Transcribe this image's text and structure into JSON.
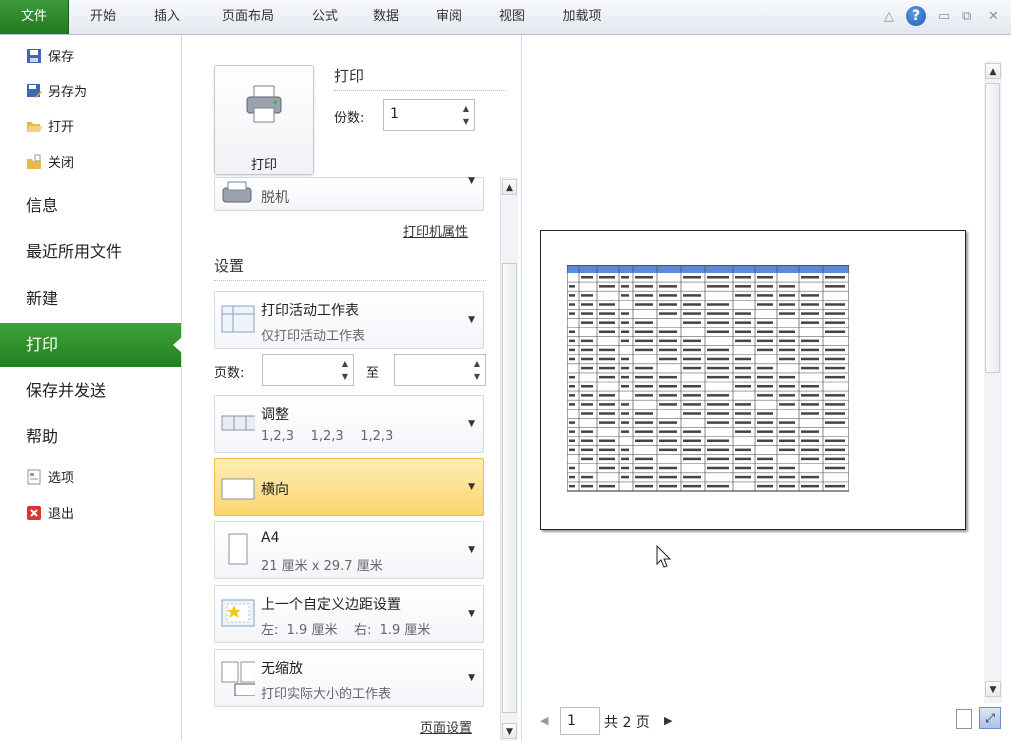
{
  "ribbon": {
    "tabs": [
      "文件",
      "开始",
      "插入",
      "页面布局",
      "公式",
      "数据",
      "审阅",
      "视图",
      "加载项"
    ],
    "window_controls": [
      "minimize-ribbon-icon",
      "help-icon",
      "minimize-icon",
      "restore-icon",
      "close-icon"
    ]
  },
  "backstage_nav": {
    "small_top": [
      {
        "label": "保存",
        "icon": "save-icon"
      },
      {
        "label": "另存为",
        "icon": "save-as-icon"
      },
      {
        "label": "打开",
        "icon": "open-folder-icon"
      },
      {
        "label": "关闭",
        "icon": "close-folder-icon"
      }
    ],
    "big": [
      "信息",
      "最近所用文件",
      "新建",
      "打印",
      "保存并发送",
      "帮助"
    ],
    "selected": "打印",
    "small_bottom": [
      {
        "label": "选项",
        "icon": "options-icon"
      },
      {
        "label": "退出",
        "icon": "exit-icon"
      }
    ]
  },
  "print": {
    "button_label": "打印",
    "section_title": "打印",
    "copies_label": "份数:",
    "copies_value": "1",
    "printer_name": "脱机",
    "printer_properties": "打印机属性",
    "settings_title": "设置",
    "what_to_print": {
      "title": "打印活动工作表",
      "subtitle": "仅打印活动工作表"
    },
    "pages_label": "页数:",
    "pages_to": "至",
    "collation": {
      "title": "调整",
      "subtitle": "1,2,3    1,2,3    1,2,3"
    },
    "orientation": {
      "title": "横向"
    },
    "paper": {
      "title": "A4",
      "subtitle": "21 厘米 x 29.7 厘米"
    },
    "margins": {
      "title": "上一个自定义边距设置",
      "subtitle": "左:  1.9 厘米    右:  1.9 厘米"
    },
    "scaling": {
      "title": "无缩放",
      "subtitle": "打印实际大小的工作表"
    },
    "page_setup_link": "页面设置"
  },
  "preview": {
    "current_page": "1",
    "total_pages_text": "共 2 页"
  },
  "colors": {
    "accent_green": "#2a8a27",
    "highlight_orange": "#fcd87a",
    "header_blue": "#5b8bd6"
  }
}
